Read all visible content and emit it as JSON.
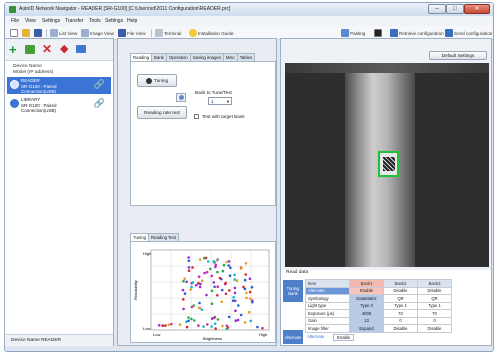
{
  "window": {
    "title": "AutoID Network Navigator - READER [SR-G100] [C:\\Users\\rd\\2011 Configuration\\READER.prc]",
    "min": "–",
    "max": "□",
    "close": "✕"
  },
  "menu": [
    "File",
    "View",
    "Settings",
    "Transfer",
    "Tools",
    "Settings",
    "Help"
  ],
  "toolbar": {
    "list_view": "List View",
    "image_view": "Image View",
    "file_view": "File View",
    "terminal": "Terminal",
    "installation_guide": "Installation Guide",
    "pasting": "Pasting",
    "retrieve": "Retrieve configuration",
    "send": "Send configuration"
  },
  "left": {
    "header_line1": "Device Name",
    "header_line2": "Model (IP address)",
    "devices": [
      {
        "name": "READER",
        "model": "SR-G100 : Paired",
        "conn": "Connection(USB)"
      },
      {
        "name": "LIBRARY",
        "model": "SR-G100 : Paired",
        "conn": "Connection(USB)"
      }
    ],
    "footer_label": "Device Name",
    "footer_value": "READER"
  },
  "mid": {
    "tabs": [
      "Reading",
      "Bank",
      "Operation",
      "Saving images",
      "Misc",
      "Tables"
    ],
    "tuning_btn": "Tuning",
    "reading_rate_btn": "Reading rate test",
    "bank_label": "Bank to Tune/Test",
    "bank_value": "1",
    "test_label": "Test with target Bank",
    "lower_tabs": [
      "Tuning",
      "Reading Test"
    ],
    "plot_y_high": "High",
    "plot_y_label": "Readability",
    "plot_y_low": "Low",
    "plot_x_low": "Low",
    "plot_x_high": "High",
    "plot_x_label": "Brightness"
  },
  "right": {
    "default_settings": "Default Settings",
    "read_data_label": "Read data",
    "side_label_1": "Tuning Bank",
    "side_label_2": "Alternate",
    "side_label_3": "Alternate",
    "alt_value": "Enable",
    "columns": [
      "Item",
      "Bank1",
      "Bank2",
      "Bank3"
    ],
    "rows": [
      [
        "Alternate",
        "Enable",
        "Disable",
        "Disable"
      ],
      [
        "Symbology",
        "DataMatrix",
        "QR",
        "QR"
      ],
      [
        "Light type",
        "Type 3",
        "Type 1",
        "Type 1"
      ],
      [
        "Exposure (μs)",
        "4000",
        "70",
        "70"
      ],
      [
        "Gain",
        "13",
        "0",
        "0"
      ],
      [
        "Image filter",
        "Expand",
        "Disable",
        "Disable"
      ]
    ]
  },
  "colors": {
    "selection": "#3a75d6",
    "accent": "#4e7fc8",
    "bank1_header": "#f3b9b0",
    "code_frame": "#22c03a"
  }
}
